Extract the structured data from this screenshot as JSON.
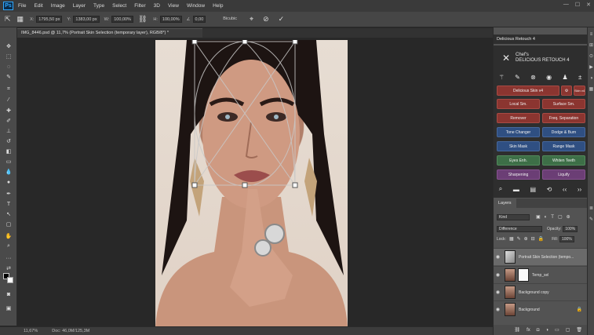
{
  "app": {
    "logo_text": "Ps"
  },
  "menu": [
    "File",
    "Edit",
    "Image",
    "Layer",
    "Type",
    "Select",
    "Filter",
    "3D",
    "View",
    "Window",
    "Help"
  ],
  "window_controls": [
    "—",
    "☐",
    "✕"
  ],
  "options_bar": {
    "x_label": "X:",
    "x_value": "1795,50 px",
    "y_label": "Y:",
    "y_value": "1383,00 px",
    "w_label": "W:",
    "w_value": "100,00%",
    "h_label": "H:",
    "h_value": "100,00%",
    "angle_label": "∠",
    "angle_value": "0,00",
    "interp_value": "Bicubic",
    "warp_icon": "warp-icon",
    "cancel_icon": "cancel-icon",
    "commit_icon": "commit-icon"
  },
  "document": {
    "tab_title": "IMG_8446.psd @ 11,7% (Portrait Skin Selection (temporary layer), RGB/8*) *",
    "zoom": "11,67%",
    "doc_size": "Doc: 46,0M/125,3M"
  },
  "tools": [
    "move",
    "marquee",
    "lasso",
    "quick-select",
    "crop",
    "eyedropper",
    "healing",
    "brush",
    "clone",
    "history-brush",
    "eraser",
    "gradient",
    "blur",
    "dodge",
    "pen",
    "type",
    "path-select",
    "shape",
    "hand",
    "zoom",
    "more",
    "colors",
    "quickmask",
    "screen-mode"
  ],
  "retouch_panel": {
    "tab_label": "Delicious Retouch 4",
    "title_line1": "Chef's",
    "title_line2": "DELICIOUS RETOUCH 4",
    "top_icons": [
      "wand-icon",
      "brush-icon",
      "stamp-icon",
      "eye-icon",
      "person-icon",
      "plus-minus-icon"
    ],
    "buttons": [
      {
        "label": "Delicious Skin v4",
        "color": "red"
      },
      {
        "label": "Local Sm.",
        "color": "red"
      },
      {
        "label": "Surface Sm.",
        "color": "red"
      },
      {
        "label": "Remover",
        "color": "red"
      },
      {
        "label": "Freq. Separation",
        "color": "red"
      },
      {
        "label": "Tone Changer",
        "color": "blue"
      },
      {
        "label": "Dodge & Burn",
        "color": "blue"
      },
      {
        "label": "Skin Mask",
        "color": "blue"
      },
      {
        "label": "Range Mask",
        "color": "blue"
      },
      {
        "label": "Eyes Enh.",
        "color": "green"
      },
      {
        "label": "Whiten Teeth",
        "color": "green"
      },
      {
        "label": "Sharpening",
        "color": "purple"
      },
      {
        "label": "Liquify",
        "color": "purple"
      }
    ],
    "side_badge": "Skin v4",
    "bottom_icons": [
      "zoom-icon",
      "grid-icon",
      "stack-icon",
      "reset-icon",
      "prev-icon",
      "next-icon"
    ]
  },
  "layers_panel": {
    "tab_label": "Layers",
    "filter_placeholder": "Kind",
    "blend_mode": "Difference",
    "opacity_label": "Opacity:",
    "opacity_value": "100%",
    "lock_label": "Lock:",
    "fill_label": "Fill:",
    "fill_value": "100%",
    "layers": [
      {
        "name": "Portrait Skin Selection (tempo...",
        "selected": true,
        "mask": "none",
        "locked": false
      },
      {
        "name": "Temp_sel",
        "selected": false,
        "mask": "white",
        "locked": false
      },
      {
        "name": "Background copy",
        "selected": false,
        "mask": "none",
        "locked": false
      },
      {
        "name": "Background",
        "selected": false,
        "mask": "none",
        "locked": true
      }
    ]
  }
}
